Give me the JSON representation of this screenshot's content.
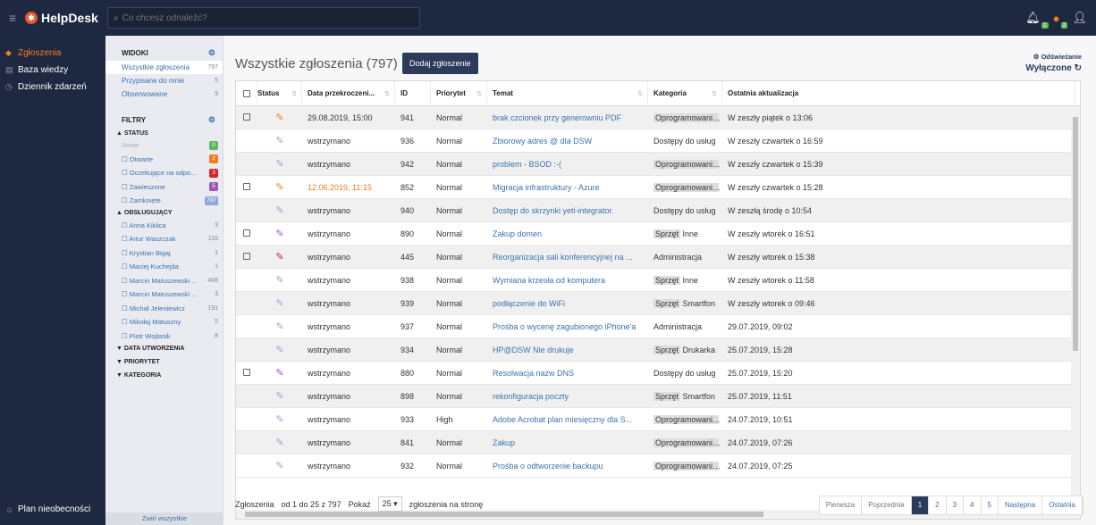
{
  "topbar": {
    "app_name": "HelpDesk",
    "search_placeholder": "Co chcesz odnaleźć?",
    "notif_count": "1",
    "chat_count": "2"
  },
  "nav": {
    "items": [
      {
        "label": "Zgłoszenia",
        "icon": "ticket-icon"
      },
      {
        "label": "Baza wiedzy",
        "icon": "book-icon"
      },
      {
        "label": "Dziennik zdarzeń",
        "icon": "clock-icon"
      }
    ],
    "bottom": "Plan nieobecności"
  },
  "views": {
    "header": "WIDOKI",
    "items": [
      {
        "label": "Wszystkie zgłoszenia",
        "count": "797"
      },
      {
        "label": "Przypisane do mnie",
        "count": "5"
      },
      {
        "label": "Obserwowane",
        "count": "9"
      }
    ]
  },
  "filters": {
    "header": "FILTRY",
    "status_header": "STATUS",
    "status": [
      {
        "label": "Nowe",
        "count": "0",
        "color": "#5cb85c"
      },
      {
        "label": "Otwarte",
        "count": "2",
        "color": "#f47c20"
      },
      {
        "label": "Oczekujące na odpo...",
        "count": "3",
        "color": "#d9232d"
      },
      {
        "label": "Zawieszone",
        "count": "5",
        "color": "#9b59b6"
      },
      {
        "label": "Zamknięte",
        "count": "787",
        "color": "#8fa8d8"
      }
    ],
    "handlers_header": "OBSŁUGUJĄCY",
    "handlers": [
      {
        "label": "Anna Kiklica",
        "count": "3"
      },
      {
        "label": "Artur Waszczak",
        "count": "116"
      },
      {
        "label": "Krystian Bigaj",
        "count": "1"
      },
      {
        "label": "Maciej Kuchejda",
        "count": "1"
      },
      {
        "label": "Marcin Matuszewski ...",
        "count": "408"
      },
      {
        "label": "Marcin Matuszewski ...",
        "count": "3"
      },
      {
        "label": "Michał Jeleniewicz",
        "count": "191"
      },
      {
        "label": "Mikołaj Matuszny",
        "count": "5"
      },
      {
        "label": "Piotr Wojtasik",
        "count": "8"
      }
    ],
    "date_header": "DATA UTWORZENIA",
    "priority_header": "PRIORYTET",
    "category_header": "KATEGORIA",
    "collapse_label": "Zwiń wszystkie"
  },
  "main": {
    "title": "Wszystkie zgłoszenia (797)",
    "add_button": "Dodaj zgłoszenie",
    "refresh_label": "Odświeżanie",
    "refresh_state": "Wyłączone"
  },
  "table": {
    "headers": [
      "Status",
      "Data przekroczeni...",
      "ID",
      "Priorytet",
      "Temat",
      "Kategoria",
      "Ostatnia aktualizacja"
    ],
    "rows": [
      {
        "chk": true,
        "status_color": "#f47c20",
        "date": "29.08.2019, 15:00",
        "date_color": "#333",
        "id": "941",
        "priority": "Normal",
        "topic": "brak czcionek przy generowniu PDF",
        "cat_tag": "Oprogramowanie",
        "cat_rest": "S...",
        "updated": "W zeszły piątek o 13:06"
      },
      {
        "chk": false,
        "status_color": "#8fa8d8",
        "date": "wstrzymano",
        "date_color": "#333",
        "id": "936",
        "priority": "Normal",
        "topic": "Zbiorowy adres @ dla DSW",
        "cat_tag": "",
        "cat_rest": "Dostępy do usług",
        "updated": "W zeszły czwartek o 16:59"
      },
      {
        "chk": false,
        "status_color": "#8fa8d8",
        "date": "wstrzymano",
        "date_color": "#333",
        "id": "942",
        "priority": "Normal",
        "topic": "problem - BSOD :-(",
        "cat_tag": "Oprogramowanie",
        "cat_rest": "S...",
        "updated": "W zeszły czwartek o 15:39"
      },
      {
        "chk": true,
        "status_color": "#f47c20",
        "date": "12.06.2019, 11:15",
        "date_color": "#f47c20",
        "id": "852",
        "priority": "Normal",
        "topic": "Migracja infrastruktury - Azure",
        "cat_tag": "Oprogramowanie",
        "cat_rest": "L...",
        "updated": "W zeszły czwartek o 15:28"
      },
      {
        "chk": false,
        "status_color": "#8fa8d8",
        "date": "wstrzymano",
        "date_color": "#333",
        "id": "940",
        "priority": "Normal",
        "topic": "Dostęp do skrzynki yeti-integrator.",
        "cat_tag": "",
        "cat_rest": "Dostępy do usług",
        "updated": "W zeszłą środę o 10:54"
      },
      {
        "chk": true,
        "status_color": "#9b59b6",
        "date": "wstrzymano",
        "date_color": "#333",
        "id": "890",
        "priority": "Normal",
        "topic": "Zakup domen",
        "cat_tag": "Sprzęt",
        "cat_rest": "Inne",
        "updated": "W zeszły wtorek o 16:51"
      },
      {
        "chk": true,
        "status_color": "#d9232d",
        "date": "wstrzymano",
        "date_color": "#333",
        "id": "445",
        "priority": "Normal",
        "topic": "Reorganizacja sali konferencyjnej na ...",
        "cat_tag": "",
        "cat_rest": "Administracja",
        "updated": "W zeszły wtorek o 15:38"
      },
      {
        "chk": false,
        "status_color": "#8fa8d8",
        "date": "wstrzymano",
        "date_color": "#333",
        "id": "938",
        "priority": "Normal",
        "topic": "Wymiana krzesła od komputera",
        "cat_tag": "Sprzęt",
        "cat_rest": "Inne",
        "updated": "W zeszły wtorek o 11:58"
      },
      {
        "chk": false,
        "status_color": "#8fa8d8",
        "date": "wstrzymano",
        "date_color": "#333",
        "id": "939",
        "priority": "Normal",
        "topic": "podłączenie do WiFi",
        "cat_tag": "Sprzęt",
        "cat_rest": "Smartfon",
        "updated": "W zeszły wtorek o 09:46"
      },
      {
        "chk": false,
        "status_color": "#8fa8d8",
        "date": "wstrzymano",
        "date_color": "#333",
        "id": "937",
        "priority": "Normal",
        "topic": "Prośba o wycenę zagubionego iPhone'a",
        "cat_tag": "",
        "cat_rest": "Administracja",
        "updated": "29.07.2019, 09:02"
      },
      {
        "chk": false,
        "status_color": "#8fa8d8",
        "date": "wstrzymano",
        "date_color": "#333",
        "id": "934",
        "priority": "Normal",
        "topic": "HP@DSW Nie drukuje",
        "cat_tag": "Sprzęt",
        "cat_rest": "Drukarka",
        "updated": "25.07.2019, 15:28"
      },
      {
        "chk": true,
        "status_color": "#9b59b6",
        "date": "wstrzymano",
        "date_color": "#333",
        "id": "880",
        "priority": "Normal",
        "topic": "Resolwacja nazw DNS",
        "cat_tag": "",
        "cat_rest": "Dostępy do usług",
        "updated": "25.07.2019, 15:20"
      },
      {
        "chk": false,
        "status_color": "#8fa8d8",
        "date": "wstrzymano",
        "date_color": "#333",
        "id": "898",
        "priority": "Normal",
        "topic": "rekonfiguracja poczty",
        "cat_tag": "Sprzęt",
        "cat_rest": "Smartfon",
        "updated": "25.07.2019, 11:51"
      },
      {
        "chk": false,
        "status_color": "#8fa8d8",
        "date": "wstrzymano",
        "date_color": "#333",
        "id": "933",
        "priority": "High",
        "topic": "Adobe Acrobat plan miesięczny dla S...",
        "cat_tag": "Oprogramowanie",
        "cat_rest": "L...",
        "updated": "24.07.2019, 10:51"
      },
      {
        "chk": false,
        "status_color": "#8fa8d8",
        "date": "wstrzymano",
        "date_color": "#333",
        "id": "841",
        "priority": "Normal",
        "topic": "Zakup",
        "cat_tag": "Oprogramowanie",
        "cat_rest": "A...",
        "updated": "24.07.2019, 07:26"
      },
      {
        "chk": false,
        "status_color": "#8fa8d8",
        "date": "wstrzymano",
        "date_color": "#333",
        "id": "932",
        "priority": "Normal",
        "topic": "Prośba o odtworzenie backupu",
        "cat_tag": "Oprogramowanie",
        "cat_rest": "S...",
        "updated": "24.07.2019, 07:25"
      }
    ]
  },
  "footer": {
    "label": "Zgłoszenia",
    "range": "od 1 do 25 z 797",
    "show": "Pokaż",
    "page_size": "25",
    "per_page": "zgłoszenia na stronę"
  },
  "pager": [
    "Pierwsza",
    "Poprzednia",
    "1",
    "2",
    "3",
    "4",
    "5",
    "Następna",
    "Ostatnia"
  ]
}
